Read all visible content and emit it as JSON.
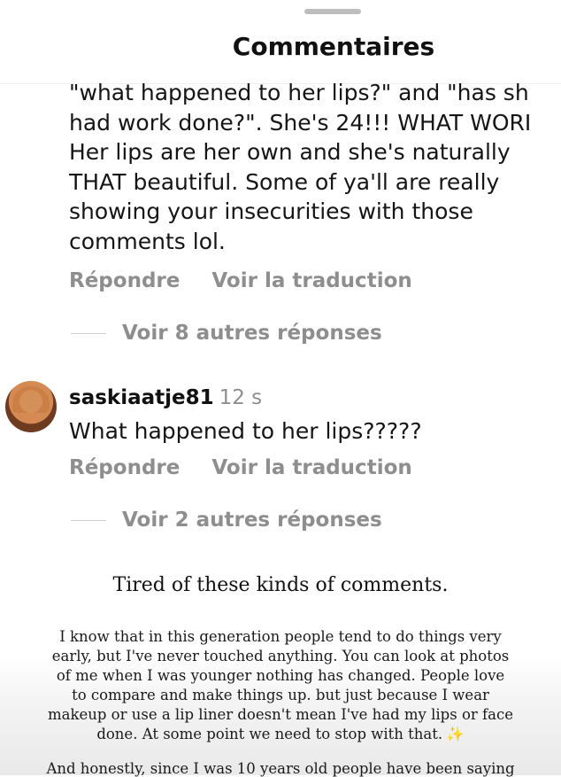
{
  "header": {
    "title": "Commentaires"
  },
  "comment1": {
    "lines": [
      "\"what happened to her lips?\" and \"has sh",
      "had work done?\". She's 24!!! WHAT WORI",
      "Her lips are her own and she's naturally",
      "THAT beautiful. Some of ya'll are really",
      "showing your insecurities with those",
      "comments lol."
    ],
    "reply_label": "Répondre",
    "translate_label": "Voir la traduction",
    "more_replies": "Voir 8 autres réponses"
  },
  "comment2": {
    "username": "saskiaatje81",
    "time": "12 s",
    "text": "What happened to her lips?????",
    "reply_label": "Répondre",
    "translate_label": "Voir la traduction",
    "more_replies": "Voir 2 autres réponses"
  },
  "story": {
    "title": "Tired  of these kinds of comments.",
    "lines": [
      "I know that in this generation people tend to do things very",
      "early, but I've never touched anything. You can look at photos",
      "of me when I was younger  nothing has changed. People love",
      "to compare and make things up. but just because I wear",
      "makeup or use a lip liner doesn't mean I've had my lips or face",
      "done. At some point we need to stop with that."
    ],
    "sparkle": "✨",
    "cut_line": "And honestly, since I was 10 years old people have been saying"
  }
}
